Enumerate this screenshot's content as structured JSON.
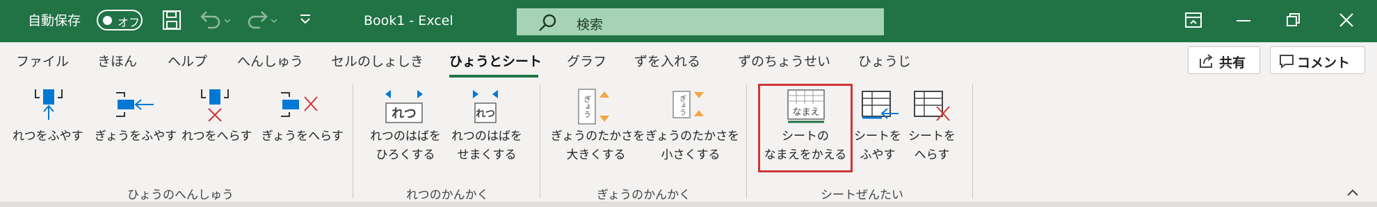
{
  "titlebar": {
    "autosave_label": "自動保存",
    "autosave_state": "オフ",
    "doc_title": "Book1  -  Excel",
    "search_placeholder": "検索"
  },
  "tabs": [
    "ファイル",
    "きほん",
    "ヘルプ",
    "へんしゅう",
    "セルのしょしき",
    "ひょうとシート",
    "グラフ",
    "ずを入れる",
    "ずのちょうせい",
    "ひょうじ"
  ],
  "active_tab": "ひょうとシート",
  "share_label": "共有",
  "comment_label": "コメント",
  "ribbon": {
    "buttons": {
      "insert_col": "れつをふやす",
      "insert_row": "ぎょうをふやす",
      "delete_col": "れつをへらす",
      "delete_row": "ぎょうをへらす",
      "widen_col_1": "れつのはばを",
      "widen_col_2": "ひろくする",
      "narrow_col_1": "れつのはばを",
      "narrow_col_2": "せまくする",
      "taller_row_1": "ぎょうのたかさを",
      "taller_row_2": "大きくする",
      "shorter_row_1": "ぎょうのたかさを",
      "shorter_row_2": "小さくする",
      "rename_sheet_1": "シートの",
      "rename_sheet_2": "なまえをかえる",
      "add_sheet_1": "シートを",
      "add_sheet_2": "ふやす",
      "remove_sheet_1": "シートを",
      "remove_sheet_2": "へらす"
    },
    "icon_text": {
      "col": "れつ",
      "col_small": "れつ",
      "row": "ぎょう",
      "name": "なまえ"
    },
    "groups": {
      "edit": "ひょうのへんしゅう",
      "col_spacing": "れつのかんかく",
      "row_spacing": "ぎょうのかんかく",
      "sheet_mgmt": "シートぜんたい"
    }
  },
  "colors": {
    "accent": "#217346",
    "highlight": "#d13438",
    "icon_blue": "#0078d4",
    "icon_red": "#d13438",
    "icon_orange": "#f2a640"
  }
}
